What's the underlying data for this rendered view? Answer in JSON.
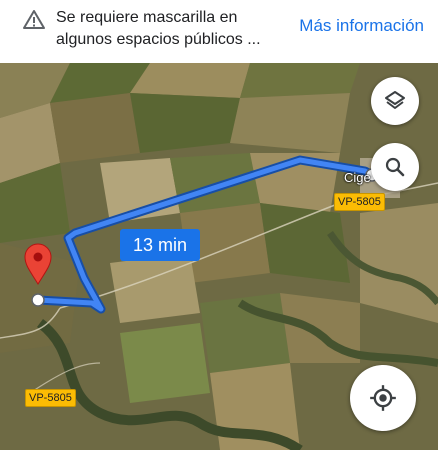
{
  "banner": {
    "message": "Se requiere mascarilla en algunos espacios públicos ...",
    "link_label": "Más información",
    "icon": "warning-icon"
  },
  "map": {
    "route_duration": "13 min",
    "road_shields": [
      "VP-5805",
      "VP-5805"
    ],
    "town_label": "Cige",
    "route_color": "#1a73e8",
    "pin_color": "#ea4335"
  },
  "controls": {
    "layers_icon": "layers-icon",
    "search_icon": "search-icon",
    "locate_icon": "my-location-icon"
  }
}
